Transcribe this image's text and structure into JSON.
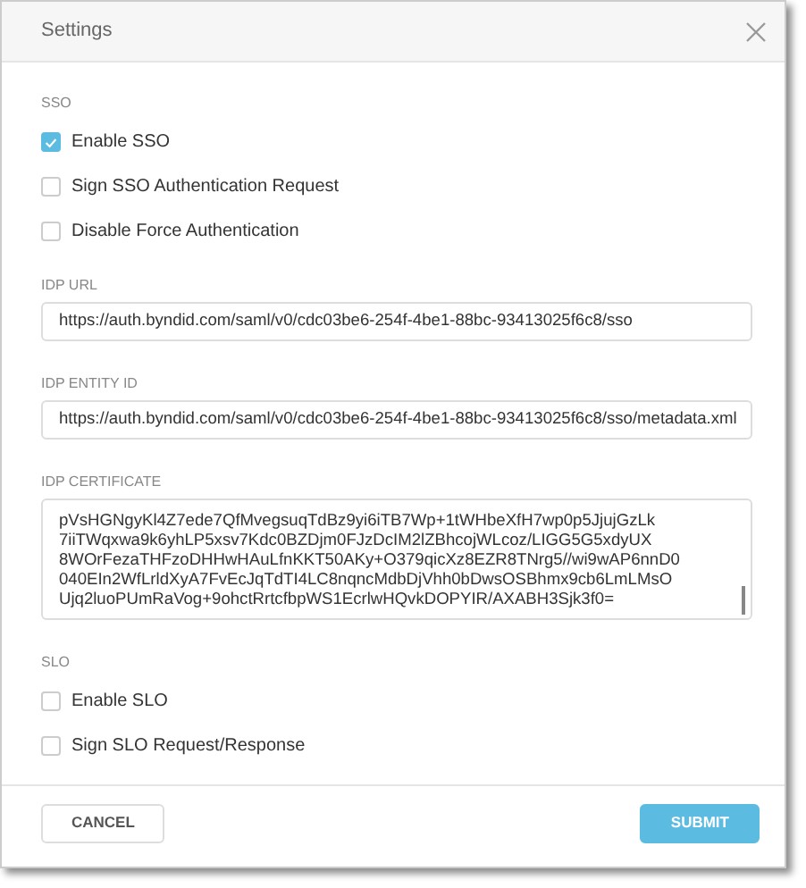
{
  "window": {
    "title": "Settings"
  },
  "sections": [
    {
      "kind": "checks",
      "label": "SSO",
      "items": [
        {
          "label": "Enable SSO",
          "checked": true
        },
        {
          "label": "Sign SSO Authentication Request",
          "checked": false
        },
        {
          "label": "Disable Force Authentication",
          "checked": false
        }
      ]
    },
    {
      "kind": "input",
      "label": "IDP URL",
      "value": "https://auth.byndid.com/saml/v0/cdc03be6-254f-4be1-88bc-93413025f6c8/sso"
    },
    {
      "kind": "input",
      "label": "IDP ENTITY ID",
      "value": "https://auth.byndid.com/saml/v0/cdc03be6-254f-4be1-88bc-93413025f6c8/sso/metadata.xml"
    },
    {
      "kind": "textarea",
      "label": "IDP CERTIFICATE",
      "lines": [
        "pVsHGNgyKl4Z7ede7QfMvegsuqTdBz9yi6iTB7Wp+1tWHbeXfH7wp0p5JjujGzLk",
        "7iiTWqxwa9k6yhLP5xsv7Kdc0BZDjm0FJzDcIM2lZBhcojWLcoz/LIGG5G5xdyUX",
        "8WOrFezaTHFzoDHHwHAuLfnKKT50AKy+O379qicXz8EZR8TNrg5//wi9wAP6nnD0",
        "040EIn2WfLrldXyA7FvEcJqTdTI4LC8nqncMdbDjVhh0bDwsOSBhmx9cb6LmLMsO",
        "Ujq2luoPUmRaVog+9ohctRrtcfbpWS1EcrlwHQvkDOPYIR/AXABH3Sjk3f0="
      ]
    },
    {
      "kind": "checks",
      "label": "SLO",
      "items": [
        {
          "label": "Enable SLO",
          "checked": false
        },
        {
          "label": "Sign SLO Request/Response",
          "checked": false
        }
      ]
    }
  ],
  "buttons": [
    {
      "label": "CANCEL",
      "kind": "secondary"
    },
    {
      "label": "SUBMIT",
      "kind": "primary"
    }
  ]
}
